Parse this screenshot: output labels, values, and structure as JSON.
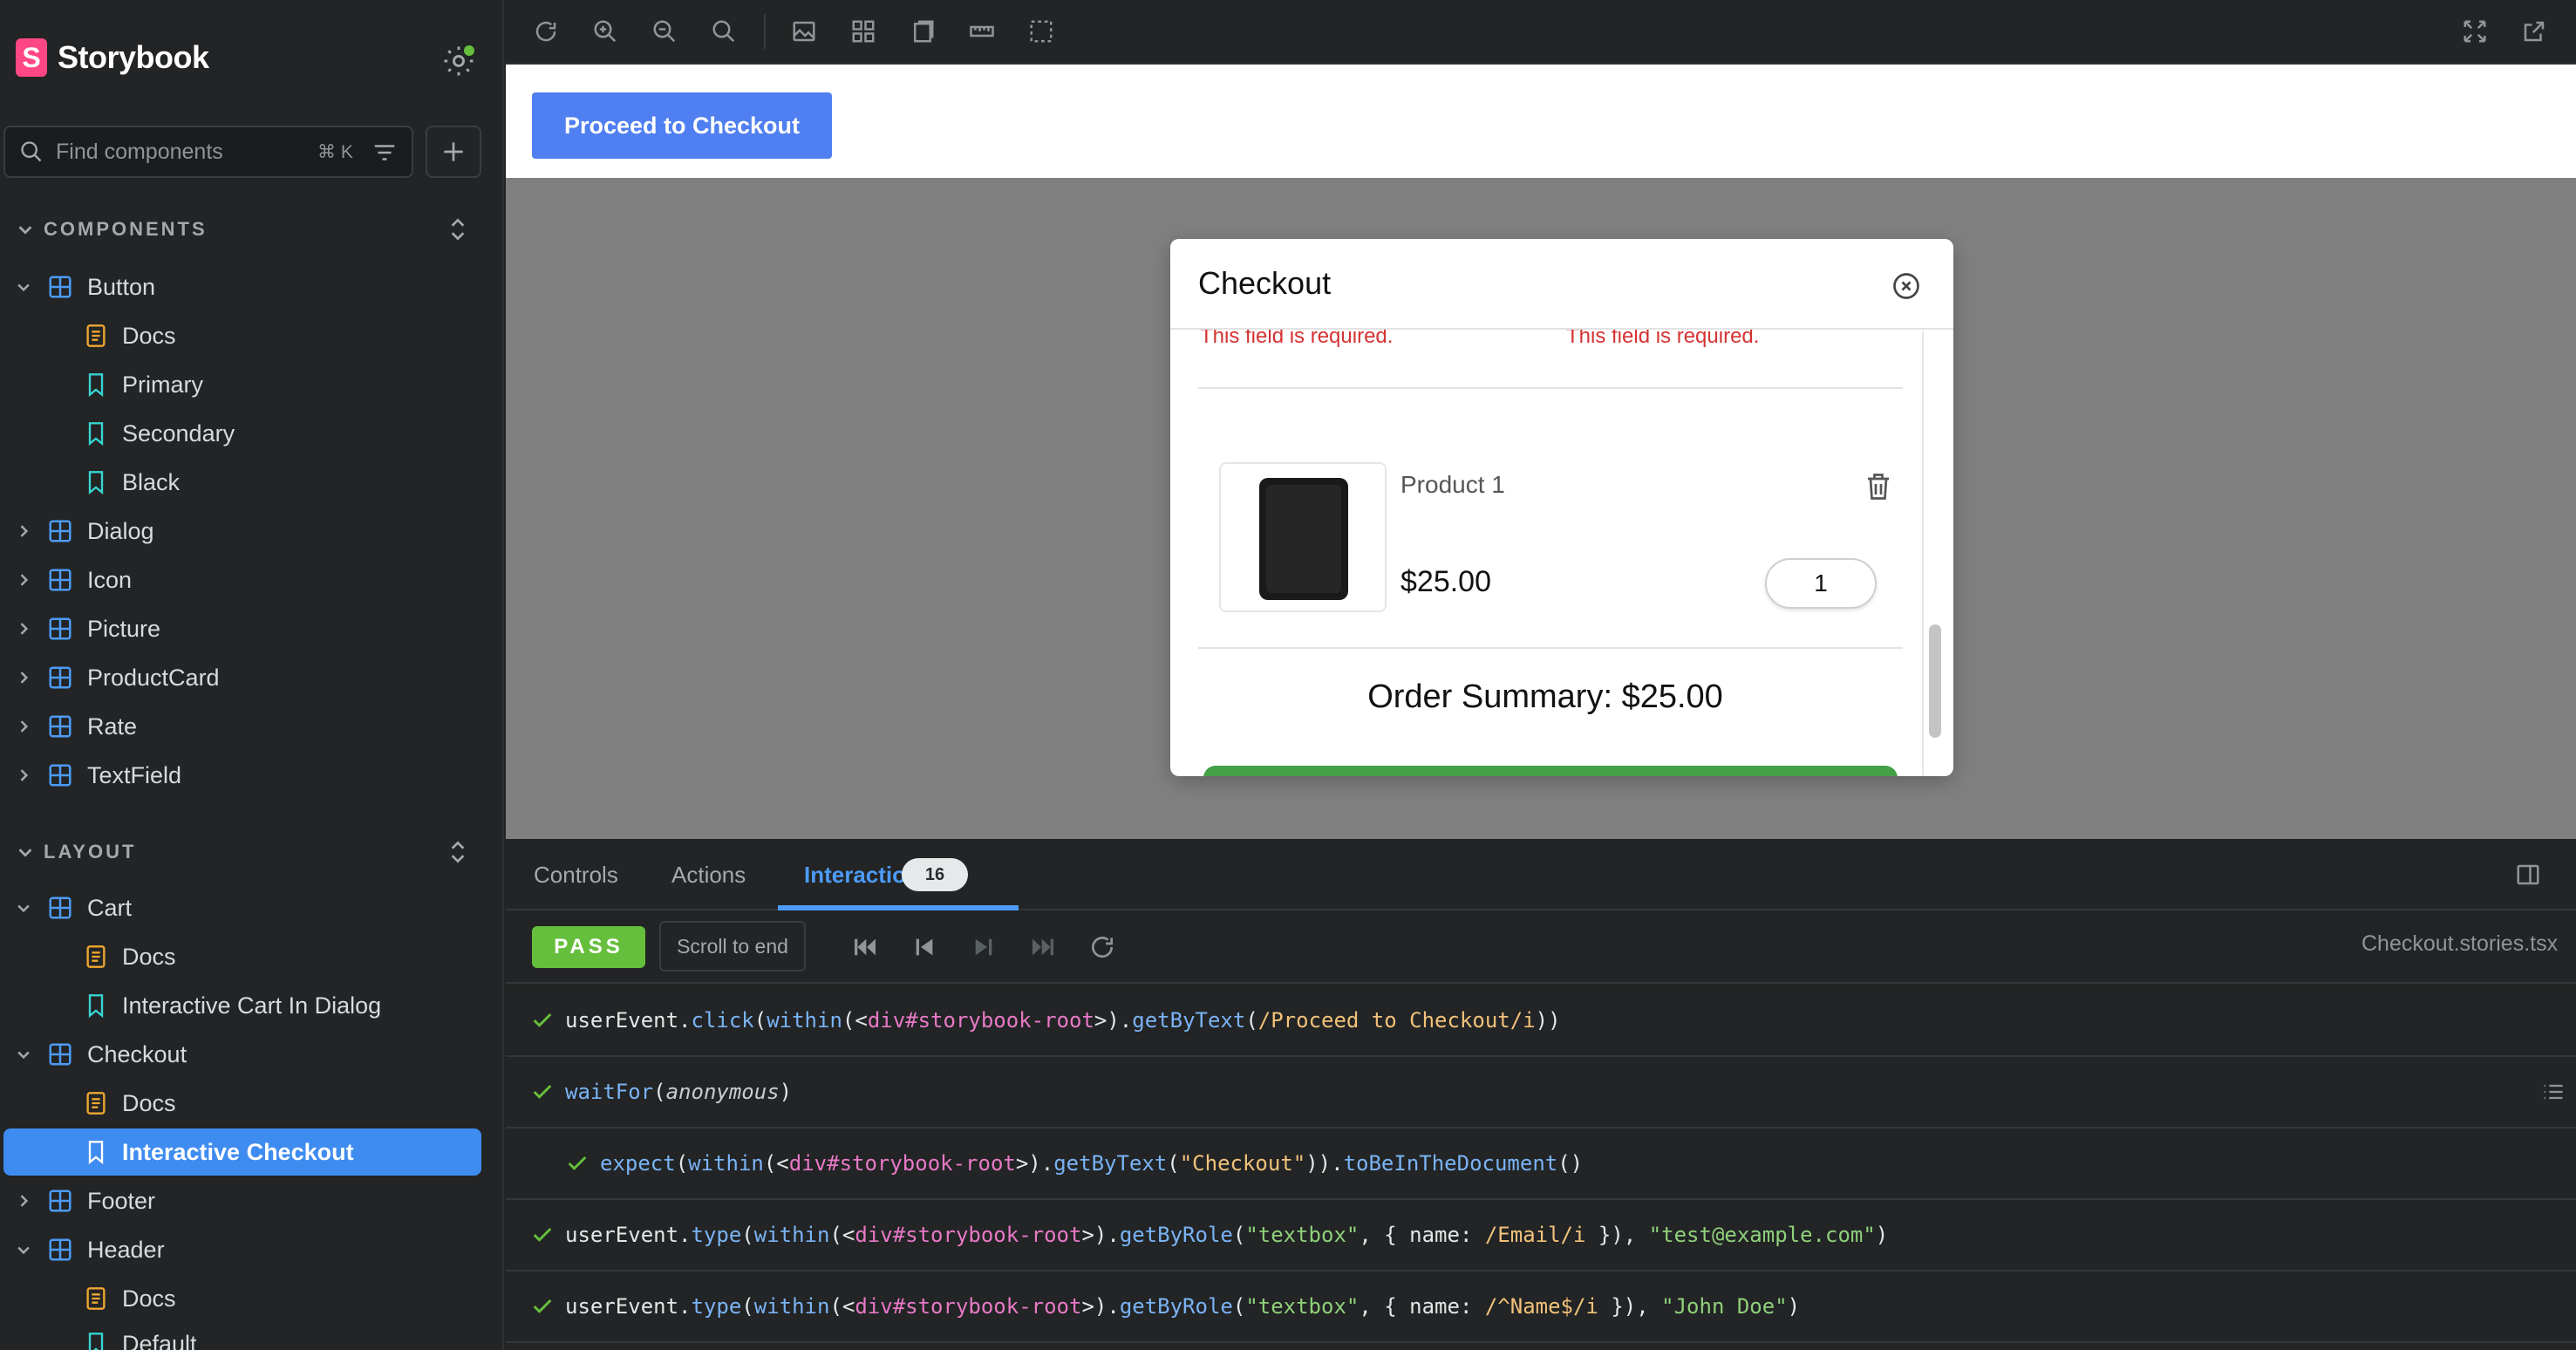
{
  "sidebar": {
    "brand": "Storybook",
    "search_placeholder": "Find components",
    "search_shortcut": "⌘ K",
    "groups": {
      "components": "COMPONENTS",
      "layout": "LAYOUT"
    },
    "items": {
      "button": "Button",
      "button_docs": "Docs",
      "button_primary": "Primary",
      "button_secondary": "Secondary",
      "button_black": "Black",
      "dialog": "Dialog",
      "icon": "Icon",
      "picture": "Picture",
      "productcard": "ProductCard",
      "rate": "Rate",
      "textfield": "TextField",
      "cart": "Cart",
      "cart_docs": "Docs",
      "cart_interactive": "Interactive Cart In Dialog",
      "checkout": "Checkout",
      "checkout_docs": "Docs",
      "checkout_interactive": "Interactive Checkout",
      "footer": "Footer",
      "header": "Header",
      "header_docs": "Docs",
      "header_default": "Default"
    }
  },
  "canvas": {
    "proceed_button": "Proceed to Checkout",
    "dialog": {
      "title": "Checkout",
      "error_left": "This field is required.",
      "error_right": "This field is required.",
      "product_name": "Product 1",
      "price": "$25.00",
      "quantity": "1",
      "summary": "Order Summary: $25.00"
    }
  },
  "panel": {
    "tabs": {
      "controls": "Controls",
      "actions": "Actions",
      "interactions": "Interactions",
      "interactions_count": "16"
    },
    "status": "PASS",
    "scroll_to_end": "Scroll to end",
    "file": "Checkout.stories.tsx",
    "log": {
      "l1": {
        "a": "userEvent.",
        "b": "click",
        "c": "(",
        "d": "within",
        "e": "(<",
        "f": "div#storybook-root",
        "g": ">).",
        "h": "getByText",
        "i": "(",
        "j": "/Proceed to Checkout/i",
        "k": "))"
      },
      "l2": {
        "a": "waitFor",
        "b": "(",
        "c": "anonymous",
        "d": ")"
      },
      "l3": {
        "a": "expect",
        "b": "(",
        "c": "within",
        "d": "(<",
        "e": "div#storybook-root",
        "f": ">).",
        "g": "getByText",
        "h": "(",
        "i": "\"Checkout\"",
        "j": ")).",
        "k": "toBeInTheDocument",
        "l": "()"
      },
      "l4": {
        "a": "userEvent.",
        "b": "type",
        "c": "(",
        "d": "within",
        "e": "(<",
        "f": "div#storybook-root",
        "g": ">).",
        "h": "getByRole",
        "i": "(",
        "j": "\"textbox\"",
        "k": ", { name: ",
        "l": "/Email/i",
        "m": " }), ",
        "n": "\"test@example.com\"",
        "o": ")"
      },
      "l5": {
        "a": "userEvent.",
        "b": "type",
        "c": "(",
        "d": "within",
        "e": "(<",
        "f": "div#storybook-root",
        "g": ">).",
        "h": "getByRole",
        "i": "(",
        "j": "\"textbox\"",
        "k": ", { name: ",
        "l": "/^Name$/i",
        "m": " }), ",
        "n": "\"John Doe\"",
        "o": ")"
      }
    }
  },
  "colors": {
    "accent": "#3f8cf0",
    "brand": "#ff4785",
    "pass": "#66bf3c",
    "error": "#d43232"
  },
  "icons": [
    "storybook-logo",
    "settings-icon",
    "search-icon",
    "filter-icon",
    "plus-icon",
    "chevron-down-icon",
    "chevron-right-icon",
    "component-icon",
    "docs-icon",
    "story-icon",
    "reload-icon",
    "zoom-in-icon",
    "zoom-out-icon",
    "zoom-reset-icon",
    "background-icon",
    "grid-icon",
    "measure-icon",
    "ruler-icon",
    "outline-icon",
    "fullscreen-icon",
    "open-new-icon",
    "close-circle-icon",
    "trash-icon",
    "check-icon",
    "list-icon"
  ]
}
